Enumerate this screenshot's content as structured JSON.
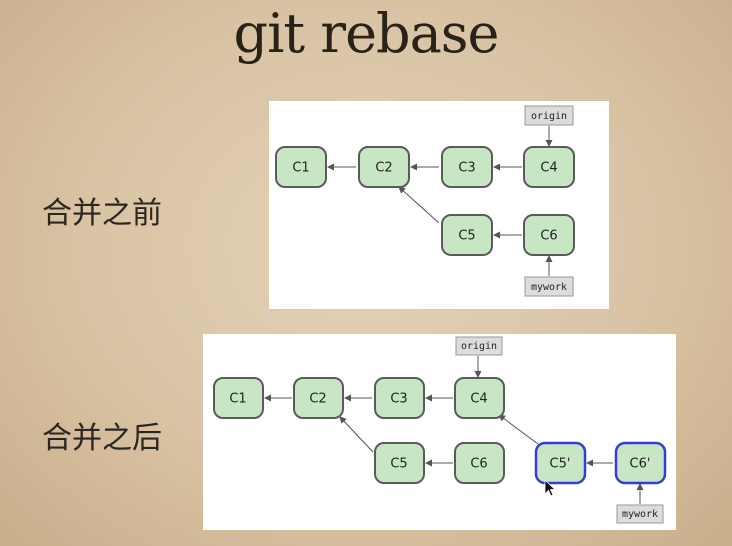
{
  "title": "git rebase",
  "before": {
    "label": "合并之前",
    "commits": [
      "C1",
      "C2",
      "C3",
      "C4",
      "C5",
      "C6"
    ],
    "refs": [
      "origin",
      "mywork"
    ]
  },
  "after": {
    "label": "合并之后",
    "commits": [
      "C1",
      "C2",
      "C3",
      "C4",
      "C5",
      "C6",
      "C5'",
      "C6'"
    ],
    "refs": [
      "origin",
      "mywork"
    ]
  }
}
